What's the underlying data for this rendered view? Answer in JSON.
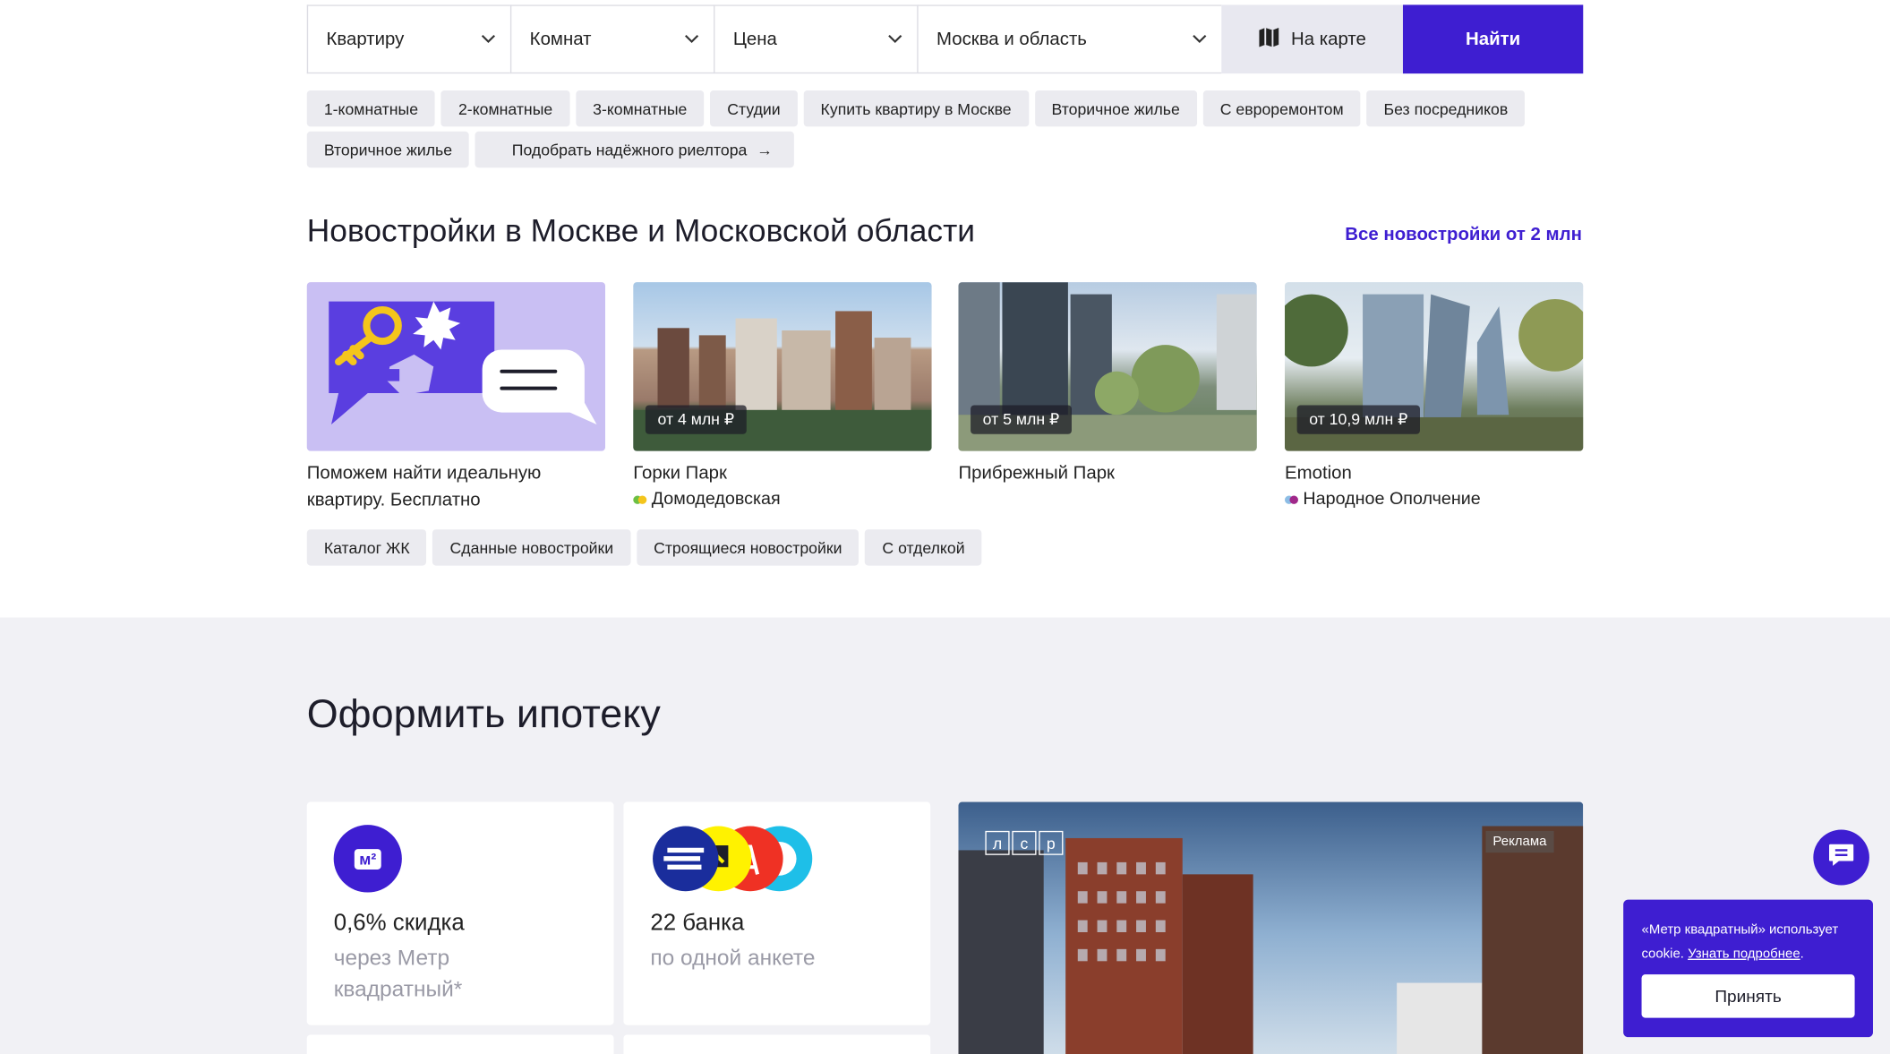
{
  "search": {
    "type_value": "Квартиру",
    "rooms_value": "Комнат",
    "price_value": "Цена",
    "region_value": "Москва и область",
    "map_button": "На карте",
    "find_button": "Найти"
  },
  "quick_filters": {
    "row1": [
      "1-комнатные",
      "2-комнатные",
      "3-комнатные",
      "Студии",
      "Купить квартиру в Москве",
      "Вторичное жилье",
      "С евроремонтом",
      "Без посредников"
    ],
    "row2_chip": "Вторичное жилье",
    "realtor_chip": "Подобрать надёжного риелтора",
    "realtor_arrow": "→"
  },
  "newbuilds": {
    "title": "Новостройки в Москве и Московской области",
    "all_link": "Все новостройки от 2 млн",
    "promo_text": "Поможем найти идеальную квартиру. Бесплатно",
    "cards": [
      {
        "price": "от 4 млн ₽",
        "name": "Горки Парк",
        "metro": "Домодедовская",
        "metro_colors": [
          "#6cbf43",
          "#f4c51c"
        ]
      },
      {
        "price": "от 5 млн ₽",
        "name": "Прибрежный Парк",
        "metro": "",
        "metro_colors": []
      },
      {
        "price": "от 10,9 млн ₽",
        "name": "Emotion",
        "metro": "Народное Ополчение",
        "metro_colors": [
          "#8cbde5",
          "#a0288a"
        ]
      }
    ],
    "chips": [
      "Каталог ЖК",
      "Сданные новостройки",
      "Строящиеся новостройки",
      "С отделкой"
    ]
  },
  "mortgage": {
    "title": "Оформить ипотеку",
    "card1_logo": "м²",
    "card1_big": "0,6% скидка",
    "card1_sub": "через Метр квадратный*",
    "card2_big": "22 банка",
    "card2_sub": "по одной анкете",
    "ad_logo": [
      "л",
      "с",
      "р"
    ],
    "ad_tag": "Реклама"
  },
  "cookie": {
    "text": "«Метр квадратный» использует cookie.",
    "link": "Узнать подробнее",
    "accept": "Принять"
  },
  "colors": {
    "accent": "#3e1ed1",
    "chip_bg": "#ebebf0",
    "section_bg": "#f1f1f5"
  }
}
